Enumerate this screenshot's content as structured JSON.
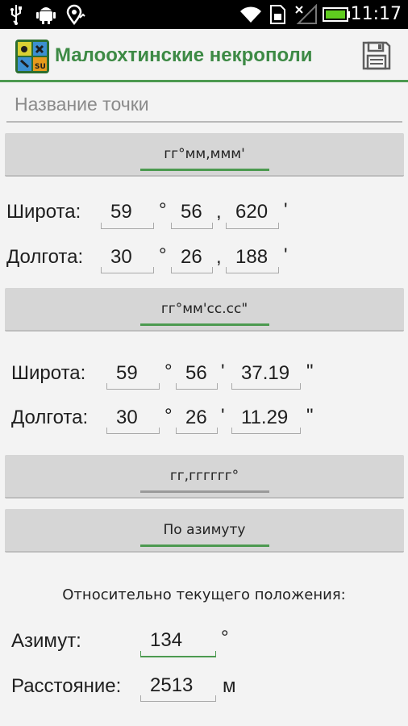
{
  "status_bar": {
    "time": "11:17",
    "icons": [
      "usb-icon",
      "android-debug-icon",
      "location-icon",
      "wifi-icon",
      "sim-icon",
      "no-signal-icon",
      "battery-icon"
    ]
  },
  "action_bar": {
    "title": "Малоохтинские некрополи",
    "save_icon": "floppy-disk-icon"
  },
  "point_name": {
    "placeholder": "Название точки",
    "value": ""
  },
  "format_dm": {
    "button_label": "гг°мм,ммм'",
    "latitude_label": "Широта:",
    "longitude_label": "Долгота:",
    "lat_deg": "59",
    "lat_min": "56",
    "lat_frac": "620",
    "lon_deg": "30",
    "lon_min": "26",
    "lon_frac": "188",
    "deg_symbol": "°",
    "comma": ",",
    "min_symbol": "'"
  },
  "format_dms": {
    "button_label": "гг°мм'сс.сс\"",
    "latitude_label": "Широта:",
    "longitude_label": "Долгота:",
    "lat_deg": "59",
    "lat_min": "56",
    "lat_sec": "37.19",
    "lon_deg": "30",
    "lon_min": "26",
    "lon_sec": "11.29",
    "deg_symbol": "°",
    "min_symbol": "'",
    "sec_symbol": "\""
  },
  "format_decimal": {
    "button_label": "гг,гггггг°"
  },
  "format_azimuth": {
    "button_label": "По азимуту",
    "relative_label": "Относительно текущего положения:",
    "azimuth_label": "Азимут:",
    "azimuth_value": "134",
    "azimuth_unit": "°",
    "distance_label": "Расстояние:",
    "distance_value": "2513",
    "distance_unit": "м"
  },
  "colors": {
    "accent": "#4c9a50",
    "title": "#3d8a45",
    "button_bg": "#d6d6d6",
    "background": "#f3f3f3"
  }
}
